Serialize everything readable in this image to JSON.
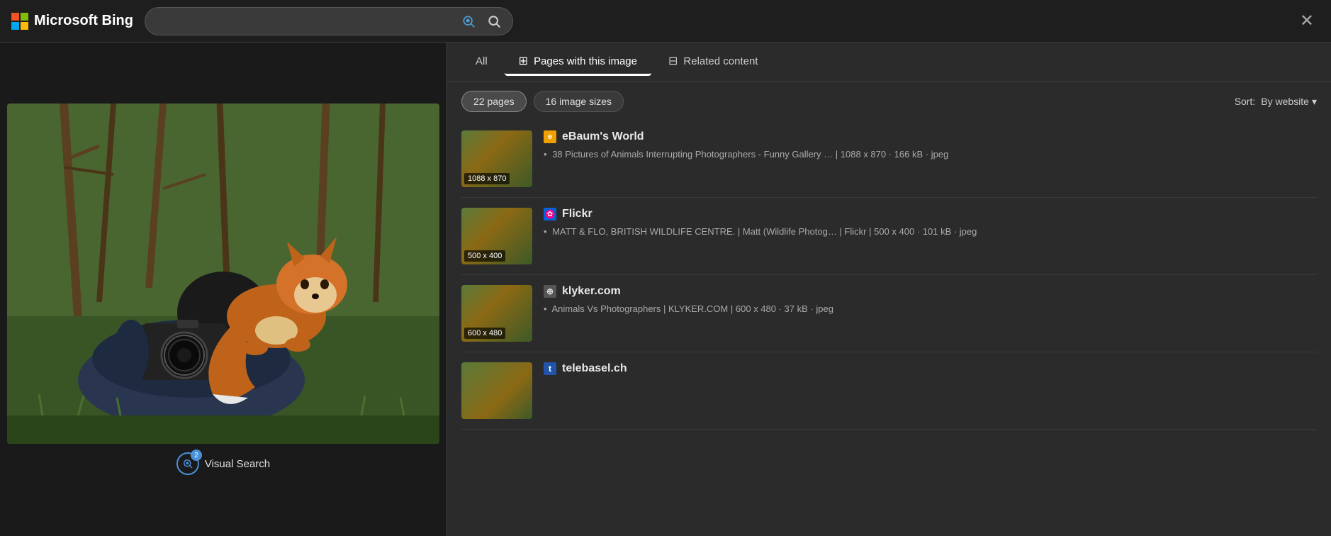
{
  "header": {
    "brand": "Microsoft Bing",
    "search_placeholder": ""
  },
  "tabs": [
    {
      "id": "all",
      "label": "All",
      "icon": "",
      "active": false
    },
    {
      "id": "pages",
      "label": "Pages with this image",
      "icon": "⊞",
      "active": true
    },
    {
      "id": "related",
      "label": "Related content",
      "icon": "⊟",
      "active": false
    }
  ],
  "filters": [
    {
      "id": "pages-count",
      "label": "22 pages",
      "active": true
    },
    {
      "id": "image-sizes",
      "label": "16 image sizes",
      "active": false
    }
  ],
  "sort": {
    "label": "Sort:",
    "value": "By website",
    "chevron": "▾"
  },
  "results": [
    {
      "id": "ebaum",
      "site_name": "eBaum's World",
      "favicon_text": "🌐",
      "favicon_color": "#f0a000",
      "thumb_label": "1088 x 870",
      "title": "38 Pictures of Animals Interrupting Photographers - Funny Gallery …",
      "meta": "1088 x 870 · 166 kB · jpeg"
    },
    {
      "id": "flickr",
      "site_name": "Flickr",
      "favicon_text": "🌸",
      "favicon_color": "#ff0084",
      "thumb_label": "500 x 400",
      "title": "MATT & FLO, BRITISH WILDLIFE CENTRE. | Matt (Wildlife Photog… | Flickr",
      "meta": "500 x 400 · 101 kB · jpeg"
    },
    {
      "id": "klyker",
      "site_name": "klyker.com",
      "favicon_text": "🌐",
      "favicon_color": "#888",
      "thumb_label": "600 x 480",
      "title": "Animals Vs Photographers | KLYKER.COM",
      "meta": "600 x 480 · 37 kB · jpeg"
    },
    {
      "id": "telebasel",
      "site_name": "telebasel.ch",
      "favicon_text": "t",
      "favicon_color": "#2255aa",
      "thumb_label": "",
      "title": "",
      "meta": ""
    }
  ],
  "visual_search": {
    "label": "Visual Search",
    "badge": "2"
  },
  "close_label": "✕"
}
